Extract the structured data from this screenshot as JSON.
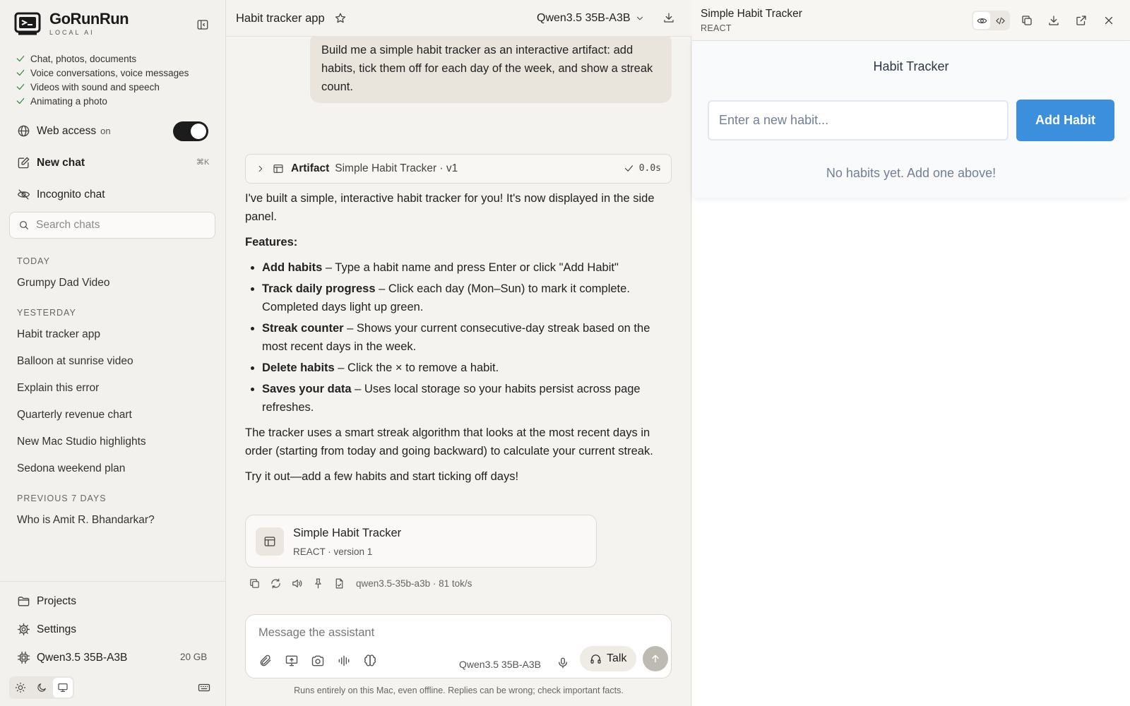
{
  "app": {
    "name": "GoRunRun",
    "tagline": "LOCAL AI"
  },
  "sidebar": {
    "features": [
      "Chat, photos, documents",
      "Voice conversations, voice messages",
      "Videos with sound and speech",
      "Animating a photo"
    ],
    "web_access": {
      "label": "Web access",
      "state": "on",
      "enabled": true
    },
    "new_chat": {
      "label": "New chat",
      "shortcut": "⌘K"
    },
    "incognito": "Incognito chat",
    "search_placeholder": "Search chats",
    "sections": [
      {
        "label": "TODAY",
        "items": [
          "Grumpy Dad Video"
        ]
      },
      {
        "label": "YESTERDAY",
        "items": [
          "Habit tracker app",
          "Balloon at sunrise video",
          "Explain this error",
          "Quarterly revenue chart",
          "New Mac Studio highlights",
          "Sedona weekend plan"
        ]
      },
      {
        "label": "PREVIOUS 7 DAYS",
        "items": [
          "Who is Amit R. Bhandarkar?"
        ]
      }
    ],
    "bottom": {
      "projects": "Projects",
      "settings": "Settings",
      "model": "Qwen3.5 35B-A3B",
      "model_size": "20 GB"
    },
    "theme": {
      "selected": "system"
    }
  },
  "chat": {
    "title": "Habit tracker app",
    "model": "Qwen3.5 35B-A3B",
    "user_message": "Build me a simple habit tracker as an interactive artifact: add habits, tick them off for each day of the week, and show a streak count.",
    "artifact_bar": {
      "label": "Artifact",
      "name": "Simple Habit Tracker · v1",
      "time": "0.0s"
    },
    "intro": "I've built a simple, interactive habit tracker for you! It's now displayed in the side panel.",
    "features_heading": "Features:",
    "bullets": [
      {
        "bold": "Add habits",
        "text": " – Type a habit name and press Enter or click \"Add Habit\""
      },
      {
        "bold": "Track daily progress",
        "text": " – Click each day (Mon–Sun) to mark it complete. Completed days light up green."
      },
      {
        "bold": "Streak counter",
        "text": " – Shows your current consecutive-day streak based on the most recent days in the week."
      },
      {
        "bold": "Delete habits",
        "text": " – Click the × to remove a habit."
      },
      {
        "bold": "Saves your data",
        "text": " – Uses local storage so your habits persist across page refreshes."
      }
    ],
    "para2": "The tracker uses a smart streak algorithm that looks at the most recent days in order (starting from today and going backward) to calculate your current streak.",
    "para3": "Try it out—add a few habits and start ticking off days!",
    "card": {
      "title": "Simple Habit Tracker",
      "subtitle": "REACT · version 1"
    },
    "meta": "qwen3.5-35b-a3b · 81 tok/s",
    "composer": {
      "placeholder": "Message the assistant",
      "model": "Qwen3.5 35B-A3B",
      "talk_label": "Talk"
    },
    "footer": "Runs entirely on this Mac, even offline. Replies can be wrong; check important facts."
  },
  "panel": {
    "title": "Simple Habit Tracker",
    "subtitle": "REACT",
    "view_mode": "preview",
    "app": {
      "heading": "Habit Tracker",
      "input_placeholder": "Enter a new habit...",
      "add_label": "Add Habit",
      "empty": "No habits yet. Add one above!"
    }
  },
  "colors": {
    "toggle_on": "#1c1c1c",
    "check_green": "#3b8a4b",
    "add_button": "#3b8fdc",
    "send_disabled": "#bdb9b3"
  }
}
